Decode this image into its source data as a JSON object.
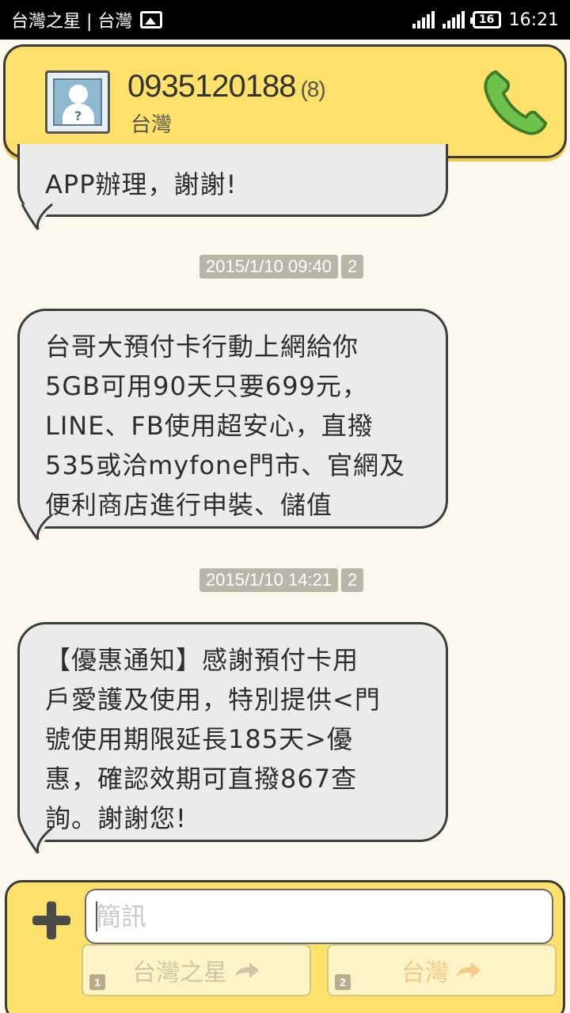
{
  "status_bar": {
    "left_text": "台灣之星 | 台灣",
    "battery": "16",
    "time": "16:21",
    "icons": [
      "picture-icon",
      "signal-icon",
      "signal-icon",
      "battery-icon"
    ]
  },
  "header": {
    "number": "0935120188",
    "count": "(8)",
    "carrier": "台灣",
    "icons": [
      "avatar-icon",
      "phone-call-icon"
    ],
    "colors": {
      "bar": "#fde16a",
      "call": "#6cc24a"
    }
  },
  "messages": [
    {
      "timestamp": null,
      "slot": null,
      "lines": [
        "APP辦理，謝謝!"
      ]
    },
    {
      "timestamp": "2015/1/10  09:40",
      "slot": "2",
      "lines": [
        "台哥大預付卡行動上網給你",
        "5GB可用90天只要699元，",
        "LINE、FB使用超安心，直撥",
        "535或洽myfone門市、官網及",
        "便利商店進行申裝、儲值"
      ]
    },
    {
      "timestamp": "2015/1/10  14:21",
      "slot": "2",
      "lines": [
        "【優惠通知】感謝預付卡用",
        "戶愛護及使用，特別提供<門",
        "號使用期限延長185天>優",
        "惠，確認效期可直撥867查",
        "詢。謝謝您!"
      ]
    }
  ],
  "composer": {
    "placeholder": "簡訊",
    "send1_label": "台灣之星",
    "send1_sim": "1",
    "send2_label": "台灣",
    "send2_sim": "2",
    "icons": [
      "plus-icon",
      "send-arrow-icon"
    ]
  }
}
